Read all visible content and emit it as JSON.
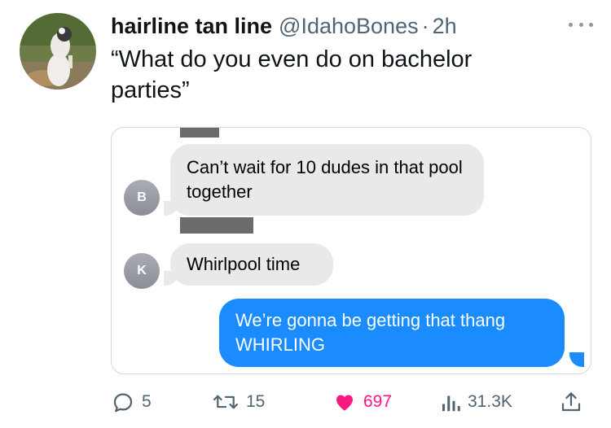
{
  "tweet": {
    "display_name": "hairline tan line",
    "handle": "@IdahoBones",
    "separator": "·",
    "time": "2h",
    "text": "“What do you even do on bachelor parties”"
  },
  "image_card": {
    "messages": [
      {
        "sender_initial": "B",
        "direction": "incoming",
        "text": "Can’t wait for 10 dudes in that pool together"
      },
      {
        "sender_initial": "K",
        "direction": "incoming",
        "text": "Whirlpool time"
      },
      {
        "direction": "outgoing",
        "text": "We’re gonna be getting that thang WHIRLING"
      }
    ]
  },
  "actions": {
    "replies": "5",
    "retweets": "15",
    "likes": "697",
    "views": "31.3K"
  },
  "colors": {
    "outgoing_bubble": "#1a8cff",
    "incoming_bubble": "#e9e9eb",
    "like": "#f91880",
    "muted": "#536471"
  },
  "icons": [
    "reply-icon",
    "retweet-icon",
    "heart-icon",
    "views-icon",
    "share-icon",
    "more-icon"
  ]
}
